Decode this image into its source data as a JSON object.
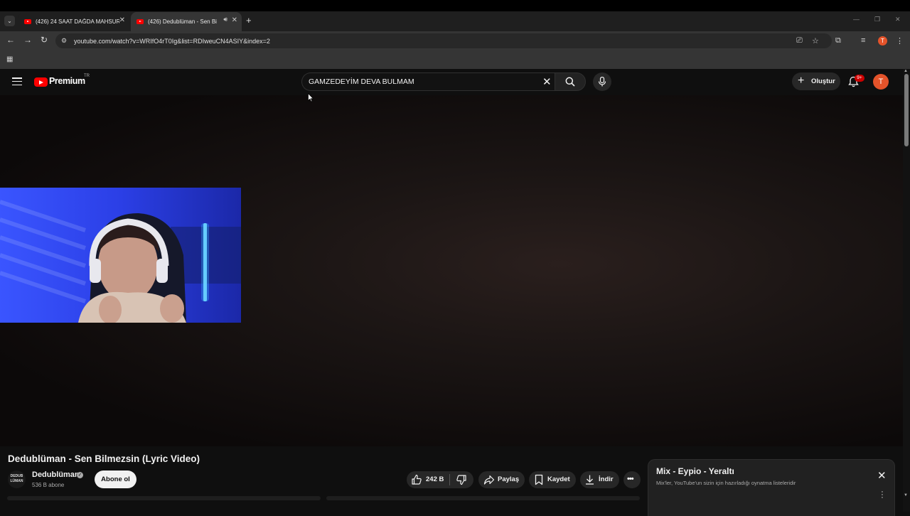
{
  "browser": {
    "tabs": [
      {
        "title": "(426) 24 SAAT DAĞDA MAHSUR",
        "active": false
      },
      {
        "title": "(426) Dedublüman - Sen Bi",
        "active": true
      }
    ],
    "url": "youtube.com/watch?v=WRIfO4rT0Ig&list=RDIweuCN4ASIY&index=2",
    "profile_initial": "T"
  },
  "masthead": {
    "brand": "Premium",
    "country_code": "TR",
    "search_query": "GAMZEDEYİM DEVA BULMAM",
    "create_label": "Oluştur",
    "notification_badge": "9+",
    "avatar_initial": "T"
  },
  "video": {
    "title": "Dedublüman - Sen Bilmezsin (Lyric Video)",
    "channel": {
      "name": "Dedublüman",
      "subscribers": "536 B abone",
      "avatar_text": "DEDUB LÜMAN"
    },
    "subscribe_label": "Abone ol",
    "actions": {
      "likes": "242 B",
      "share": "Paylaş",
      "save": "Kaydet",
      "download": "İndir"
    }
  },
  "mix": {
    "title": "Mix - Eypio - Yeraltı",
    "subtitle": "Mix'ler, YouTube'un sizin için hazırladığı oynatma listeleridir"
  },
  "colors": {
    "youtube_red": "#ff0000",
    "avatar": "#e4532a",
    "badge": "#cc0000"
  }
}
